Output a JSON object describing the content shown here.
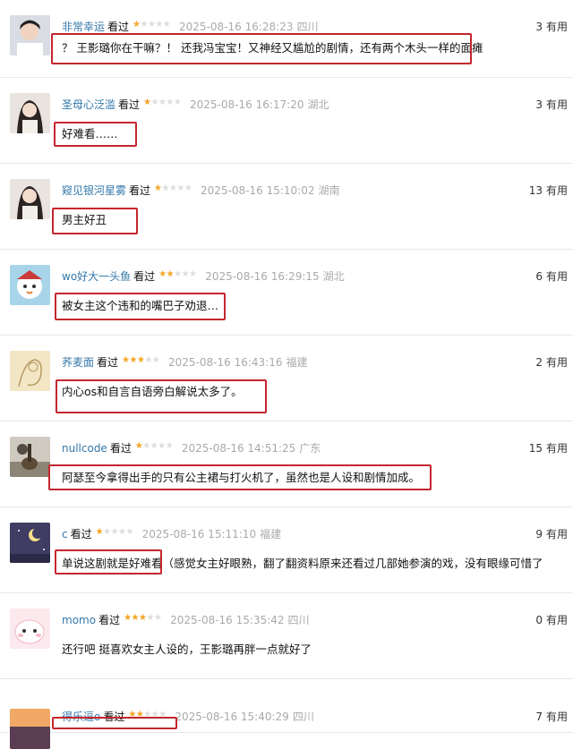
{
  "watched_label": "看过",
  "useful_label": "有用",
  "rating_star_symbol": "★★★★★",
  "star_color": "#f5a623",
  "highlight_color": "#c4262e",
  "reviews": [
    {
      "username": "非常幸运",
      "rating": 1,
      "time": "2025-08-16 16:28:23",
      "location": "四川",
      "useful": "3",
      "content": "？ 王影璐你在干嘛？！ 还我冯宝宝！又神经又尴尬的剧情，还有两个木头一样的面瘫",
      "avatar": "boy-icon"
    },
    {
      "username": "圣母心泛滥",
      "rating": 1,
      "time": "2025-08-16 16:17:20",
      "location": "湖北",
      "useful": "3",
      "content": "好难看……",
      "avatar": "girl-icon"
    },
    {
      "username": "窥见银河星雾",
      "rating": 1,
      "time": "2025-08-16 15:10:02",
      "location": "湖南",
      "useful": "13",
      "content": "男主好丑",
      "avatar": "girl-icon"
    },
    {
      "username": "wo好大一头鱼",
      "rating": 2,
      "time": "2025-08-16 16:29:15",
      "location": "湖北",
      "useful": "6",
      "content": "被女主这个违和的嘴巴子劝退…",
      "avatar": "cartoon-bird-icon"
    },
    {
      "username": "荞麦面",
      "rating": 3,
      "time": "2025-08-16 16:43:16",
      "location": "福建",
      "useful": "2",
      "content": "内心os和自言自语旁白解说太多了。",
      "avatar": "sketch-icon"
    },
    {
      "username": "nullcode",
      "rating": 1,
      "time": "2025-08-16 14:51:25",
      "location": "广东",
      "useful": "15",
      "content": "阿瑟至今拿得出手的只有公主裙与打火机了，虽然也是人设和剧情加成。",
      "avatar": "guitar-icon"
    },
    {
      "username": "c",
      "rating": 1,
      "time": "2025-08-16 15:11:10",
      "location": "福建",
      "useful": "9",
      "content": "单说这剧就是好难看（感觉女主好眼熟，翻了翻资料原来还看过几部她参演的戏，没有眼缘可惜了",
      "avatar": "moon-icon"
    },
    {
      "username": "momo",
      "rating": 3,
      "time": "2025-08-16 15:35:42",
      "location": "四川",
      "useful": "0",
      "content": "还行吧 挺喜欢女主人设的，王影璐再胖一点就好了",
      "avatar": "cartoon-pink-icon"
    },
    {
      "username": "得乐逗o",
      "rating": 2,
      "time": "2025-08-16 15:40:29",
      "location": "四川",
      "useful": "7",
      "content": "",
      "avatar": "sunset-icon"
    }
  ]
}
